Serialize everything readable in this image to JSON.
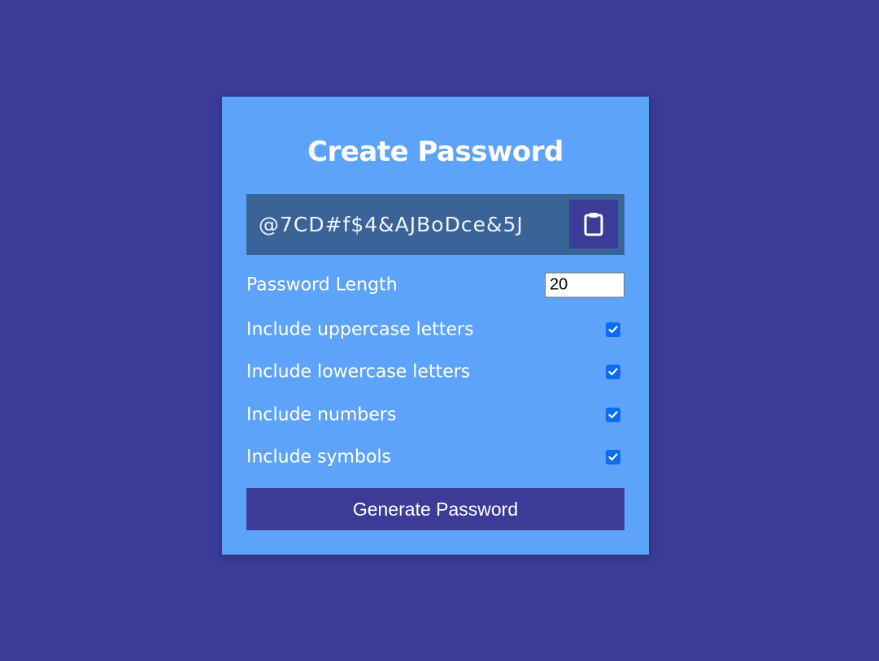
{
  "title": "Create Password",
  "password": "@7CD#f$4&AJBoDce&5J",
  "copy_icon": "clipboard-icon",
  "length": {
    "label": "Password Length",
    "value": "20"
  },
  "options": [
    {
      "label": "Include uppercase letters",
      "checked": true
    },
    {
      "label": "Include lowercase letters",
      "checked": true
    },
    {
      "label": "Include numbers",
      "checked": true
    },
    {
      "label": "Include symbols",
      "checked": true
    }
  ],
  "generate_label": "Generate Password",
  "colors": {
    "page_background": "#3b3b98",
    "card_background": "#5da2fb",
    "result_background": "#3a6396",
    "button_background": "#3b3b98",
    "checkbox_accent": "#0a6cf5"
  }
}
